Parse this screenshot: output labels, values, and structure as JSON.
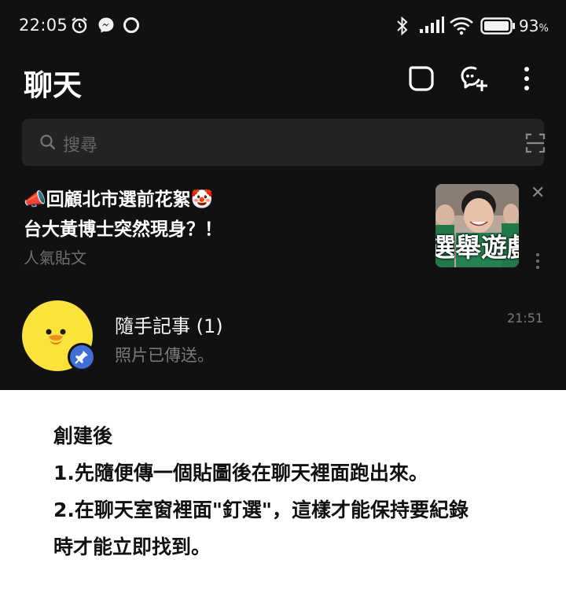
{
  "status_bar": {
    "time": "22:05",
    "battery_percent": "93",
    "battery_unit": "%",
    "icons": [
      "alarm-icon",
      "messenger-icon",
      "circle-notification-icon",
      "bluetooth-icon",
      "signal-icon",
      "wifi-icon",
      "battery-icon"
    ]
  },
  "header": {
    "title": "聊天",
    "actions": [
      "edit-icon",
      "add-chat-icon",
      "more-vertical-icon"
    ]
  },
  "search": {
    "placeholder": "搜尋",
    "icons": [
      "search-icon",
      "scan-icon"
    ]
  },
  "promo": {
    "line1": "📣回顧北市選前花絮🤡",
    "line2": "台大黃博士突然現身？！",
    "subtitle": "人氣貼文",
    "thumbnail_text": "選舉遊戲",
    "close": "✕"
  },
  "chat_list": [
    {
      "name": "隨手記事 (1)",
      "last_message": "照片已傳送。",
      "time": "21:51",
      "pinned": true
    }
  ],
  "note": {
    "lines": [
      "創建後",
      "1.先隨便傳一個貼圖後在聊天裡面跑出來。",
      "2.在聊天室窗裡面\"釘選\"，這樣才能保持要紀錄",
      "時才能立即找到。"
    ]
  },
  "colors": {
    "app_background": "#111111",
    "search_background": "#232323",
    "avatar_yellow": "#fbe33a",
    "pin_blue": "#3e6fd8",
    "note_background": "#ffffff"
  }
}
